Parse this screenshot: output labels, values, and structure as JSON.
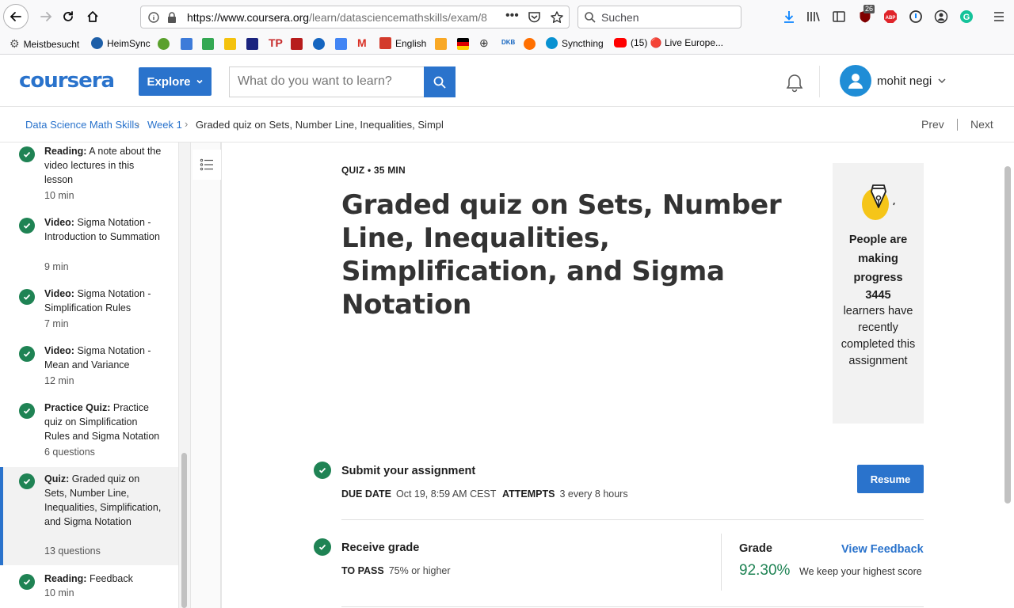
{
  "browser": {
    "url_domain": "https://www.coursera.org",
    "url_path": "/learn/datasciencemathskills/exam/8",
    "search_placeholder": "Suchen",
    "badge_count": "26",
    "bookmarks": [
      {
        "label": "Meistbesucht",
        "icon": "gear-icon",
        "color": "#555555"
      },
      {
        "label": "HeimSync",
        "icon": "sync-icon",
        "color": "#1e5fa8"
      },
      {
        "label": "English",
        "icon": "flag-icon",
        "color": "#d33b2c"
      },
      {
        "label": "Syncthing",
        "icon": "syncthing-icon",
        "color": "#0891d1"
      },
      {
        "label": "(15) 🔴 Live Europe...",
        "icon": "youtube-icon",
        "color": "#ff0000"
      }
    ]
  },
  "header": {
    "logo": "coursera",
    "explore_label": "Explore",
    "search_placeholder": "What do you want to learn?",
    "user_name": "mohit negi"
  },
  "breadcrumb": {
    "course": "Data Science Math Skills",
    "week": "Week 1",
    "current": "Graded quiz on Sets, Number Line, Inequalities, Simpl",
    "prev": "Prev",
    "next": "Next"
  },
  "sidebar": {
    "items": [
      {
        "type": "Reading:",
        "title": "A note about the video lectures in this lesson",
        "meta": "10 min"
      },
      {
        "type": "Video:",
        "title": "Sigma Notation - Introduction to Summation",
        "meta": "9 min"
      },
      {
        "type": "Video:",
        "title": "Sigma Notation - Simplification Rules",
        "meta": "7 min"
      },
      {
        "type": "Video:",
        "title": "Sigma Notation - Mean and Variance",
        "meta": "12 min"
      },
      {
        "type": "Practice Quiz:",
        "title": "Practice quiz on Simplification Rules and Sigma Notation",
        "meta": "6 questions"
      },
      {
        "type": "Quiz:",
        "title": "Graded quiz on Sets, Number Line, Inequalities, Simplification, and Sigma Notation",
        "meta": "13 questions"
      },
      {
        "type": "Reading:",
        "title": "Feedback",
        "meta": "10 min"
      }
    ]
  },
  "main": {
    "quiz_label": "QUIZ • 35 MIN",
    "title": "Graded quiz on Sets, Number Line, Inequalities, Simplification, and Sigma Notation",
    "progress_card": {
      "heading": "People are making progress",
      "count": "3445",
      "text": "learners have recently completed this assignment"
    },
    "submit": {
      "title": "Submit your assignment",
      "due_label": "DUE DATE",
      "due_value": "Oct 19, 8:59 AM CEST",
      "attempts_label": "ATTEMPTS",
      "attempts_value": "3 every 8 hours",
      "resume_label": "Resume"
    },
    "grade": {
      "title": "Receive grade",
      "pass_label": "TO PASS",
      "pass_value": "75% or higher",
      "grade_label": "Grade",
      "view_feedback": "View Feedback",
      "grade_value": "92.30%",
      "grade_note": "We keep your highest score"
    }
  },
  "colors": {
    "brand": "#2a73cc",
    "success": "#1f8354"
  }
}
